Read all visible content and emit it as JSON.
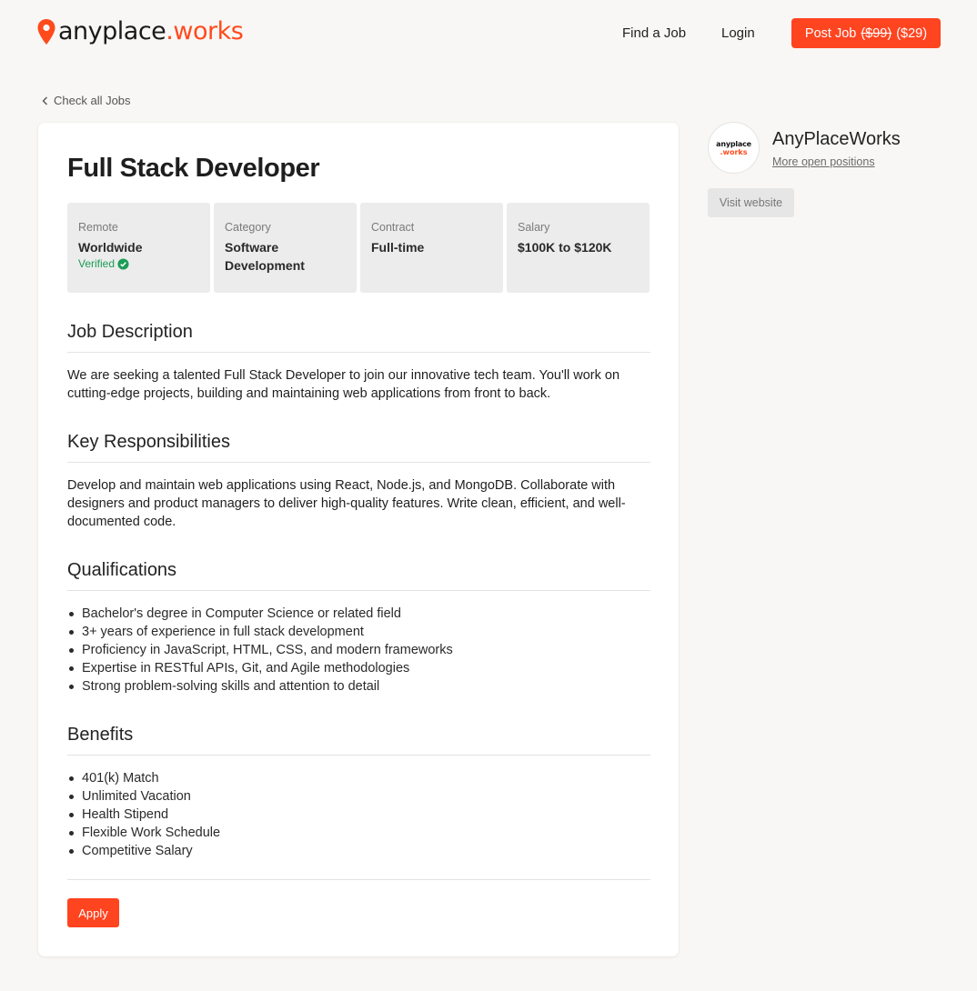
{
  "header": {
    "logo": {
      "part1": "anyplace",
      "part2": ".works"
    },
    "nav": {
      "find_job": "Find a Job",
      "login": "Login"
    },
    "post_job": {
      "label": "Post Job",
      "old_price": "($99)",
      "new_price": "($29)"
    }
  },
  "back_link": "Check all Jobs",
  "job": {
    "title": "Full Stack Developer",
    "facts": [
      {
        "label": "Remote",
        "value": "Worldwide",
        "badge": "Verified"
      },
      {
        "label": "Category",
        "value": "Software Development"
      },
      {
        "label": "Contract",
        "value": "Full-time"
      },
      {
        "label": "Salary",
        "value": "$100K to $120K"
      }
    ],
    "sections": {
      "description": {
        "title": "Job Description",
        "text": "We are seeking a talented Full Stack Developer to join our innovative tech team. You'll work on cutting-edge projects, building and maintaining web applications from front to back."
      },
      "responsibilities": {
        "title": "Key Responsibilities",
        "text": "Develop and maintain web applications using React, Node.js, and MongoDB. Collaborate with designers and product managers to deliver high-quality features. Write clean, efficient, and well-documented code."
      },
      "qualifications": {
        "title": "Qualifications",
        "items": [
          "Bachelor's degree in Computer Science or related field",
          "3+ years of experience in full stack development",
          "Proficiency in JavaScript, HTML, CSS, and modern frameworks",
          "Expertise in RESTful APIs, Git, and Agile methodologies",
          "Strong problem-solving skills and attention to detail"
        ]
      },
      "benefits": {
        "title": "Benefits",
        "items": [
          "401(k) Match",
          "Unlimited Vacation",
          "Health Stipend",
          "Flexible Work Schedule",
          "Competitive Salary"
        ]
      }
    },
    "apply_label": "Apply"
  },
  "company": {
    "logo_line1": "anyplace",
    "logo_line2": ".works",
    "name": "AnyPlaceWorks",
    "more_positions": "More open positions",
    "visit_website": "Visit website"
  },
  "colors": {
    "accent": "#ff4420",
    "verified": "#1a9d57",
    "fact_bg": "#ececec",
    "page_bg": "#f8f7f5"
  },
  "icons": {
    "logo": "map-pin-icon",
    "back": "chevron-left-icon",
    "verified": "check-circle-icon"
  }
}
